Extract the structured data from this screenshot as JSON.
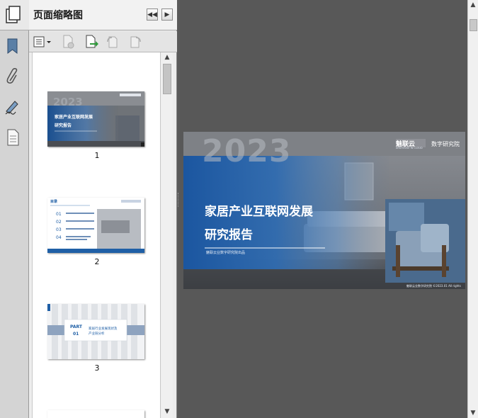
{
  "panel": {
    "title": "页面缩略图",
    "header_buttons": {
      "collapse_icon": "double-chevron-left-icon",
      "close_icon": "chevron-right-icon"
    },
    "toolbar_icons": [
      "options-icon",
      "delete-page-icon",
      "insert-page-icon",
      "rotate-left-icon",
      "rotate-right-icon"
    ]
  },
  "tool_strip": [
    "bookmark-icon",
    "attachment-icon",
    "signature-icon",
    "page-icon"
  ],
  "thumbnails": [
    {
      "page": "1",
      "selected": false
    },
    {
      "page": "2",
      "selected": false
    },
    {
      "page": "3",
      "selected": false
    }
  ],
  "page2": {
    "title": "目录",
    "items": [
      "01",
      "02",
      "03",
      "04"
    ]
  },
  "page3": {
    "part": "PART",
    "part_num": "01",
    "heading": "家居行业发展现状及产业链分析"
  },
  "slide": {
    "year": "2023",
    "title_line1": "家居产业互联网发展",
    "title_line2": "研究报告",
    "subtitle": "魅联云业数字研究院出品",
    "brand_left": "魅联云",
    "brand_left_sub": "ARKHOUSE IN CLOUD",
    "brand_right": "数字研究院",
    "footer": "魅联云业数字研究院 ©2023.01 All rights"
  },
  "colors": {
    "accent": "#1f5fa6",
    "bg": "#585858",
    "panel": "#ededed"
  }
}
